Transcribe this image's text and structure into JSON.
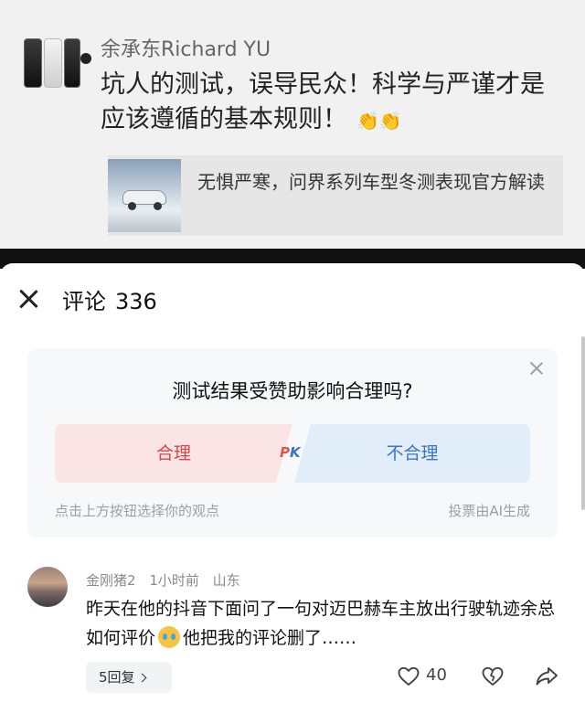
{
  "post": {
    "author": "余承东Richard YU",
    "text": "坑人的测试，误导民众！科学与严谨才是应该遵循的基本规则！",
    "link_card_title": "无惧严寒，问界系列车型冬测表现官方解读"
  },
  "comments_panel": {
    "title": "评论",
    "count": "336"
  },
  "poll": {
    "question": "测试结果受赞助影响合理吗?",
    "option_yes": "合理",
    "option_no": "不合理",
    "pk_p": "P",
    "pk_k": "K",
    "hint": "点击上方按钮选择你的观点",
    "ai_note": "投票由AI生成"
  },
  "comment": {
    "username": "金刚猪2",
    "time": "1小时前",
    "location": "山东",
    "text_before_emoji": "昨天在他的抖音下面问了一句对迈巴赫车主放出行驶轨迹余总如何评价",
    "text_after_emoji": "他把我的评论删了……",
    "reply_label": "5回复",
    "like_count": "40"
  },
  "colors": {
    "yes_bg": "#fbe5e4",
    "yes_text": "#d04848",
    "no_bg": "#e2edfa",
    "no_text": "#3b74c6"
  },
  "icons": [
    "close-icon",
    "poll-close-icon",
    "chevron-right-icon",
    "heart-icon",
    "dislike-icon",
    "share-icon",
    "clap-emoji-icon",
    "crying-emoji-icon"
  ]
}
